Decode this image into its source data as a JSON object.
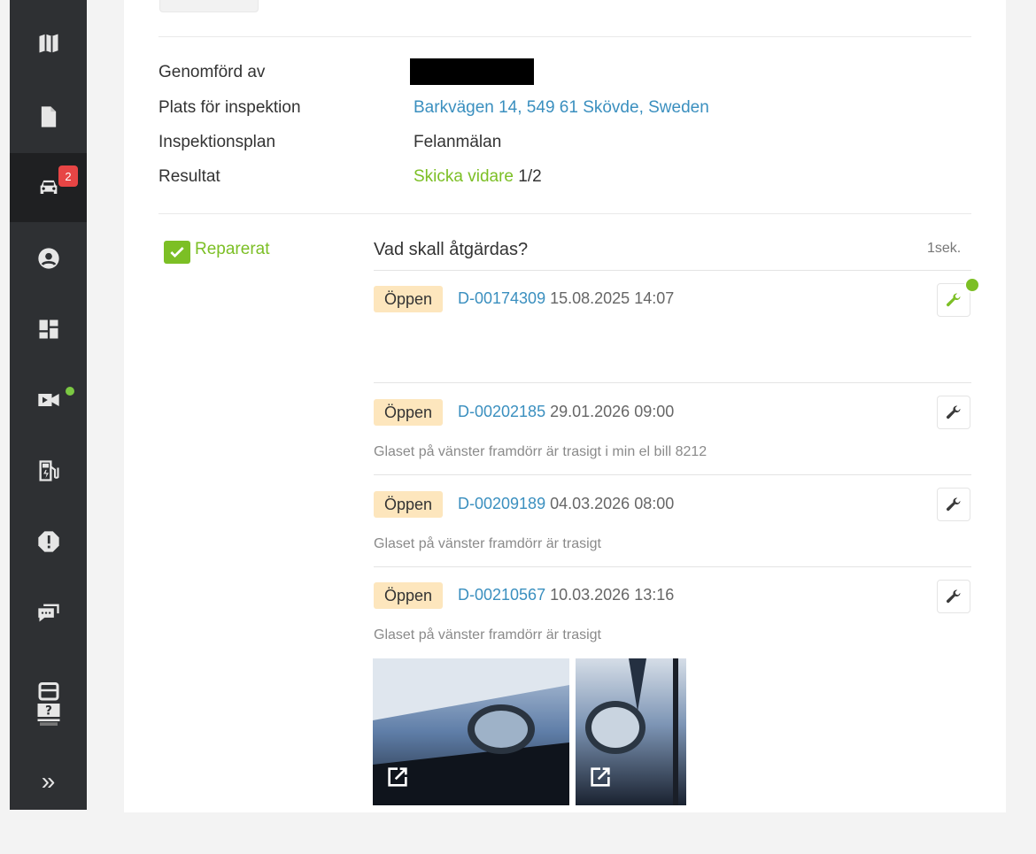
{
  "sidebar": {
    "items": [
      {
        "icon": "map-icon"
      },
      {
        "icon": "document-icon"
      },
      {
        "icon": "car-icon",
        "badge": "2",
        "active": true
      },
      {
        "icon": "user-icon"
      },
      {
        "icon": "dashboard-icon"
      },
      {
        "icon": "video-icon",
        "status_dot": true
      },
      {
        "icon": "fuel-icon"
      },
      {
        "icon": "alert-icon"
      },
      {
        "icon": "chat-icon"
      },
      {
        "icon": "help-icon"
      }
    ],
    "expand_label": "»"
  },
  "info": {
    "performed_by_label": "Genomförd av",
    "location_label": "Plats för inspektion",
    "location_value": "Barkvägen 14, 549 61 Skövde, Sweden",
    "plan_label": "Inspektionsplan",
    "plan_value": "Felanmälan",
    "result_label": "Resultat",
    "result_value": "Skicka vidare",
    "result_count": "1/2"
  },
  "item": {
    "status_label": "Reparerat",
    "question": "Vad skall åtgärdas?",
    "time": "1sek."
  },
  "tickets": [
    {
      "status": "Öppen",
      "id": "D-00174309",
      "datetime": "15.08.2025 14:07",
      "description": "",
      "done": true
    },
    {
      "status": "Öppen",
      "id": "D-00202185",
      "datetime": "29.01.2026 09:00",
      "description": "Glaset på vänster framdörr är trasigt i min el bill 8212"
    },
    {
      "status": "Öppen",
      "id": "D-00209189",
      "datetime": "04.03.2026 08:00",
      "description": "Glaset på vänster framdörr är trasigt"
    },
    {
      "status": "Öppen",
      "id": "D-00210567",
      "datetime": "10.03.2026 13:16",
      "description": "Glaset på vänster framdörr är trasigt"
    }
  ],
  "colors": {
    "accent_green": "#7cbf25",
    "link_blue": "#3a8fbf",
    "badge_red": "#e74545",
    "tag_bg": "#fde6bd"
  }
}
